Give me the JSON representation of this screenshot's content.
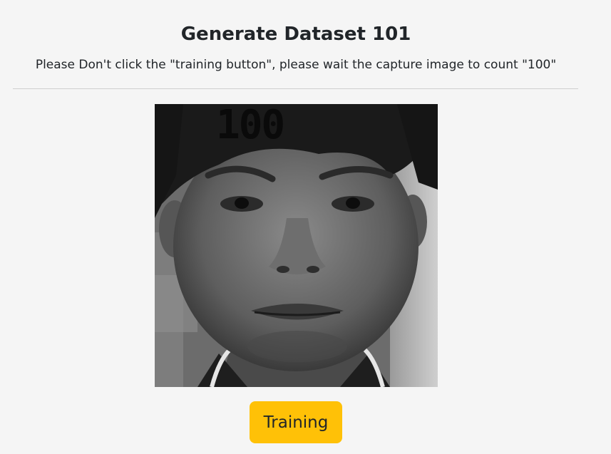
{
  "header": {
    "title": "Generate Dataset 101",
    "instructions": "Please Don't click the \"training button\", please wait the capture image to count \"100\""
  },
  "capture": {
    "count": "100",
    "image_description": "grayscale webcam face capture"
  },
  "actions": {
    "training_label": "Training",
    "training_color": "#ffc107"
  }
}
